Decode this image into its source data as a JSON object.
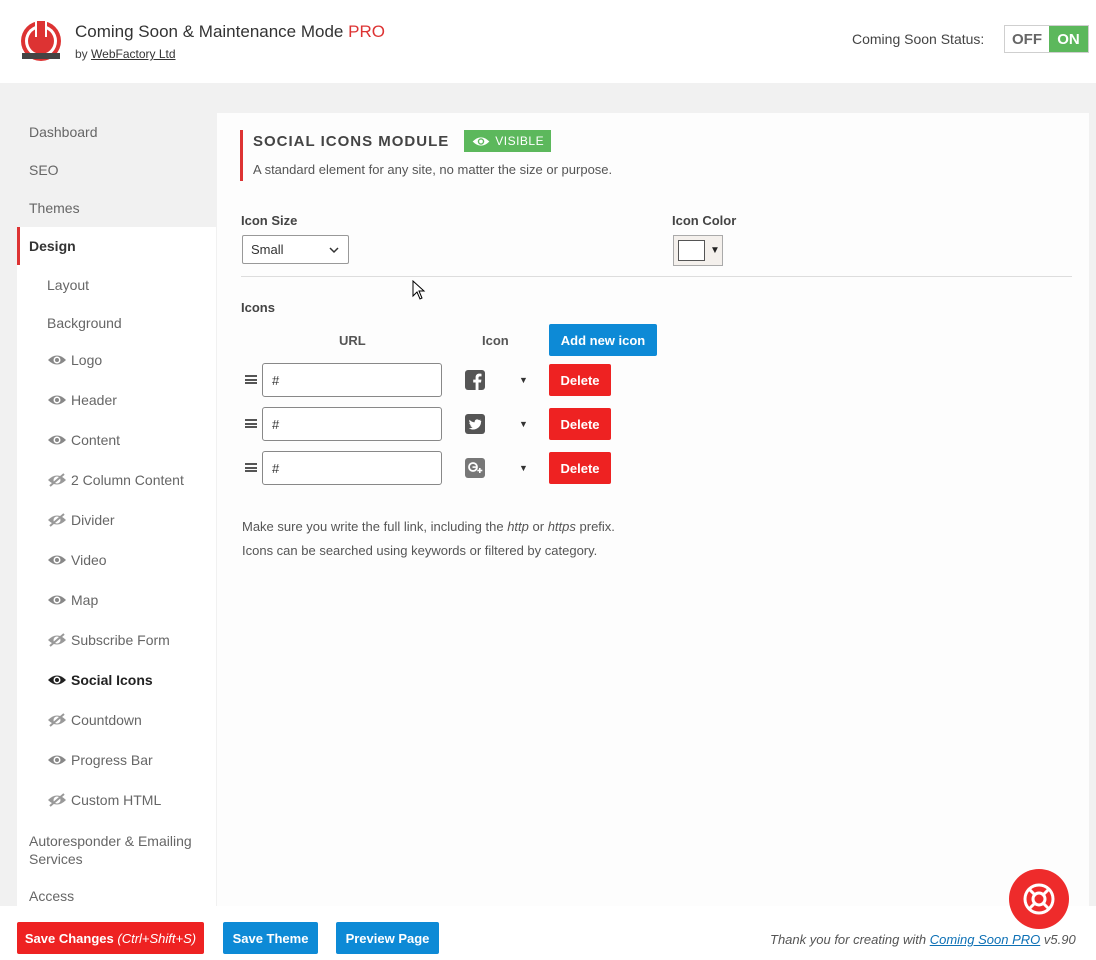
{
  "header": {
    "title": "Coming Soon & Maintenance Mode",
    "pro_label": "PRO",
    "by_prefix": "by",
    "by_link": "WebFactory Ltd",
    "status_label": "Coming Soon Status:",
    "toggle_off": "OFF",
    "toggle_on": "ON"
  },
  "sidebar": {
    "top_items": [
      "Dashboard",
      "SEO",
      "Themes",
      "Design"
    ],
    "sub_items": [
      {
        "label": "Layout",
        "icon": "none"
      },
      {
        "label": "Background",
        "icon": "none"
      },
      {
        "label": "Logo",
        "icon": "eye-icon"
      },
      {
        "label": "Header",
        "icon": "eye-icon"
      },
      {
        "label": "Content",
        "icon": "eye-icon"
      },
      {
        "label": "2 Column Content",
        "icon": "eye-slash-icon"
      },
      {
        "label": "Divider",
        "icon": "eye-slash-icon"
      },
      {
        "label": "Video",
        "icon": "eye-icon"
      },
      {
        "label": "Map",
        "icon": "eye-icon"
      },
      {
        "label": "Subscribe Form",
        "icon": "eye-slash-icon"
      },
      {
        "label": "Social Icons",
        "icon": "eye-icon"
      },
      {
        "label": "Countdown",
        "icon": "eye-slash-icon"
      },
      {
        "label": "Progress Bar",
        "icon": "eye-icon"
      },
      {
        "label": "Custom HTML",
        "icon": "eye-slash-icon"
      }
    ],
    "bottom_items": [
      "Autoresponder & Emailing Services",
      "Access"
    ]
  },
  "module": {
    "title": "SOCIAL ICONS MODULE",
    "badge": "VISIBLE",
    "description": "A standard element for any site, no matter the size or purpose.",
    "icon_size_label": "Icon Size",
    "icon_size_value": "Small",
    "icon_color_label": "Icon Color",
    "icon_color_value": "#ffffff",
    "icons_label": "Icons",
    "col_url": "URL",
    "col_icon": "Icon",
    "add_button": "Add new icon",
    "rows": [
      {
        "url": "#",
        "icon": "facebook-icon",
        "delete": "Delete"
      },
      {
        "url": "#",
        "icon": "twitter-icon",
        "delete": "Delete"
      },
      {
        "url": "#",
        "icon": "google-plus-icon",
        "delete": "Delete"
      }
    ],
    "note_1_pre": "Make sure you write the full link, including the",
    "note_1_http": "http",
    "note_1_or": "or",
    "note_1_https": "https",
    "note_1_post": "prefix.",
    "note_2": "Icons can be searched using keywords or filtered by category."
  },
  "footer": {
    "save_changes": "Save Changes",
    "save_shortcut": "(Ctrl+Shift+S)",
    "save_theme": "Save Theme",
    "preview_page": "Preview Page",
    "thanks_pre": "Thank you for creating with",
    "thanks_link": "Coming Soon PRO",
    "version": "v5.90"
  },
  "colors": {
    "brand_red": "#dd3333",
    "visible_green": "#5cb85c",
    "primary_blue": "#0d8ad6",
    "delete_red": "#ee2222"
  }
}
